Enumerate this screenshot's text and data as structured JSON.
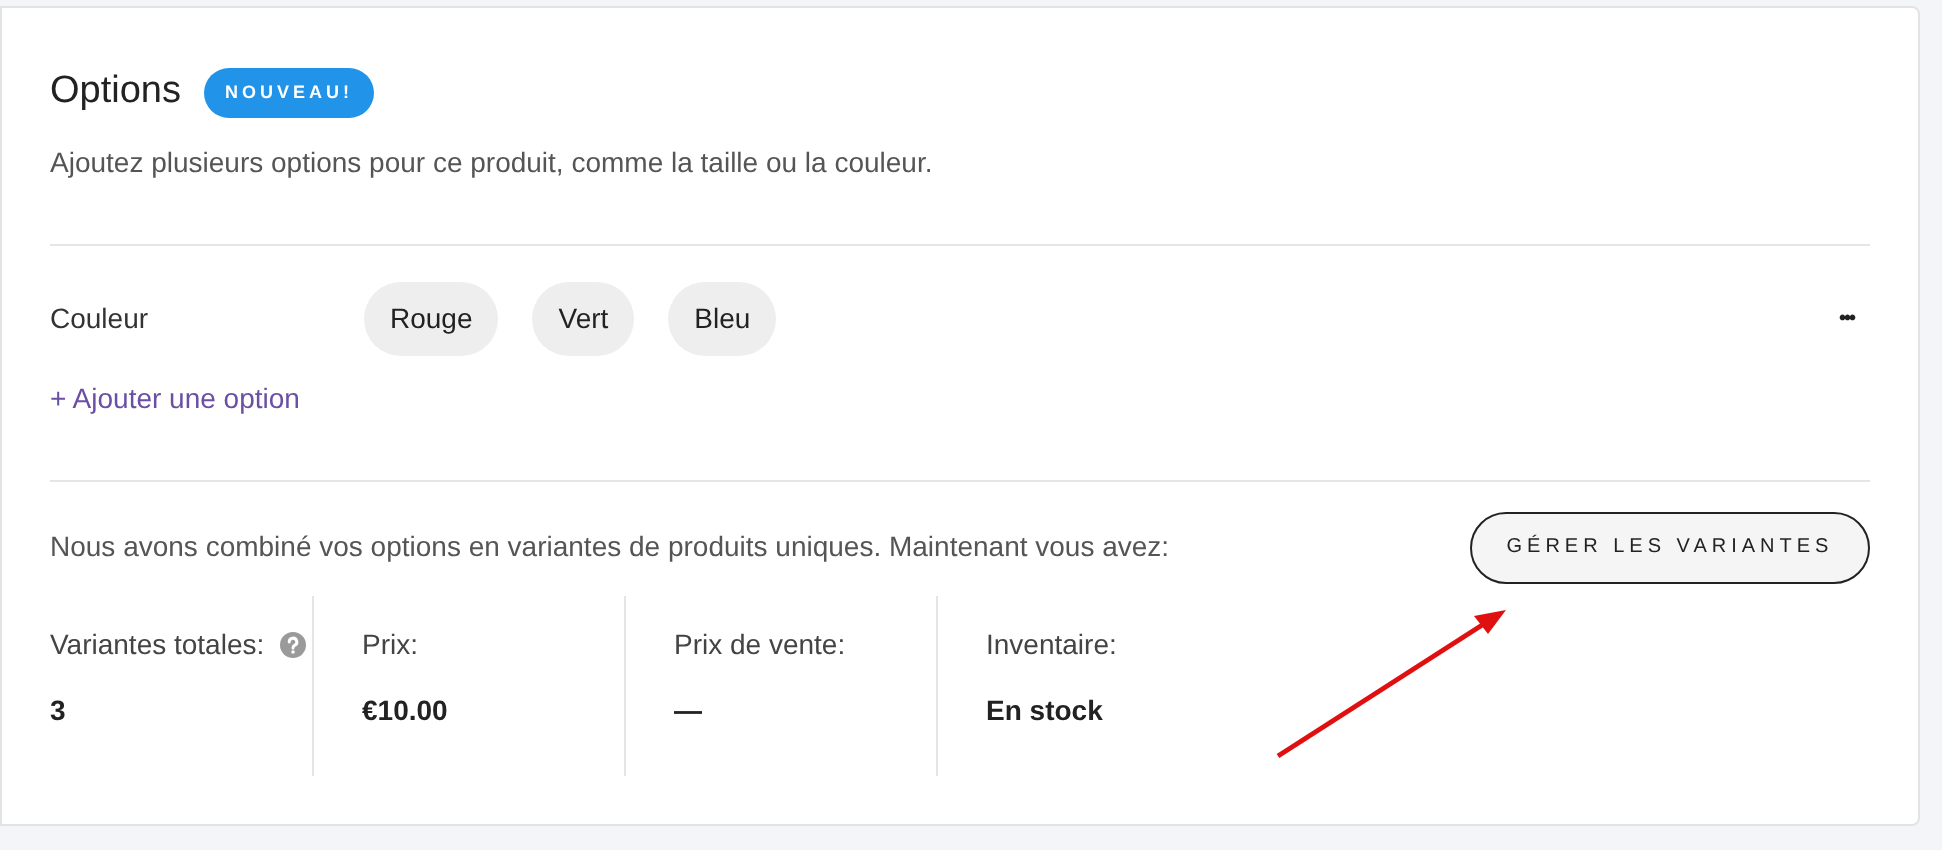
{
  "title": "Options",
  "badge": "NOUVEAU!",
  "description": "Ajoutez plusieurs options pour ce produit, comme la taille ou la couleur.",
  "options": [
    {
      "name": "Couleur",
      "values": [
        "Rouge",
        "Vert",
        "Bleu"
      ],
      "menu": "•••"
    }
  ],
  "add_option": "+ Ajouter une option",
  "summary": "Nous avons combiné vos options en variantes de produits uniques. Maintenant vous avez:",
  "manage_button": "GÉRER LES VARIANTES",
  "stats": [
    {
      "label": "Variantes totales:",
      "value": "3",
      "help": true
    },
    {
      "label": "Prix:",
      "value": "€10.00",
      "help": false
    },
    {
      "label": "Prix de vente:",
      "value": "—",
      "help": false
    },
    {
      "label": "Inventaire:",
      "value": "En stock",
      "help": false
    }
  ]
}
